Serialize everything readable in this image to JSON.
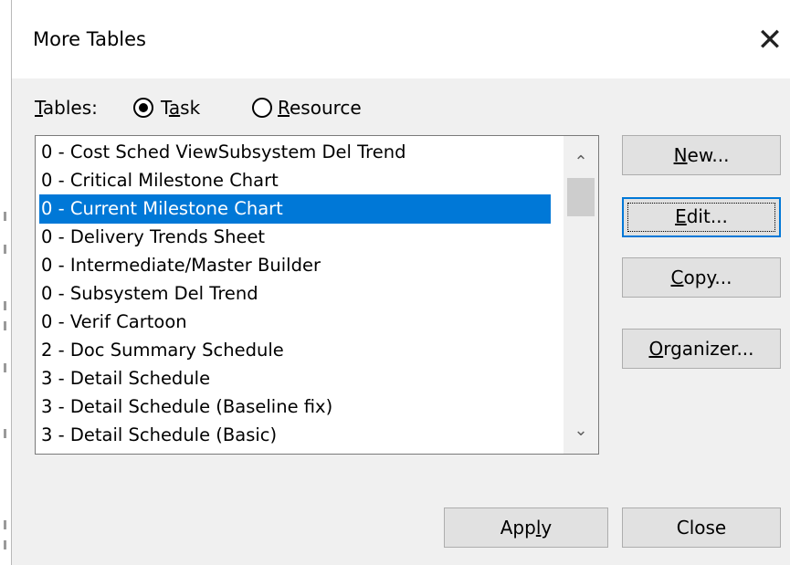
{
  "dialog": {
    "title": "More Tables",
    "close_glyph": "✕"
  },
  "tables_selector": {
    "label": "Tables:",
    "options": [
      {
        "label": "Task",
        "mnemonic_index": 1,
        "selected": true
      },
      {
        "label": "Resource",
        "mnemonic_index": 0,
        "selected": false
      }
    ]
  },
  "table_list": {
    "items": [
      "0 - Cost Sched ViewSubsystem Del Trend",
      "0 - Critical Milestone Chart",
      "0 - Current Milestone Chart",
      "0 - Delivery Trends Sheet",
      "0 - Intermediate/Master Builder",
      "0 - Subsystem Del Trend",
      "0 - Verif Cartoon",
      "2 - Doc Summary Schedule",
      "3 - Detail Schedule",
      "3 - Detail Schedule (Baseline fix)",
      "3 - Detail Schedule (Basic)"
    ],
    "selected_index": 2,
    "scroll_up_icon": "chevron-up-icon",
    "scroll_down_icon": "chevron-down-icon"
  },
  "side_buttons": {
    "new": {
      "label": "New...",
      "mnemonic_index": 0
    },
    "edit": {
      "label": "Edit...",
      "mnemonic_index": 0
    },
    "copy": {
      "label": "Copy...",
      "mnemonic_index": 0
    },
    "organizer": {
      "label": "Organizer...",
      "mnemonic_index": 0
    }
  },
  "footer_buttons": {
    "apply": {
      "label": "Apply",
      "mnemonic_index": 3
    },
    "close": {
      "label": "Close"
    }
  },
  "colors": {
    "selection": "#0078d7",
    "dialog_bg": "#f0f0f0",
    "button_bg": "#e1e1e1",
    "default_button_border": "#0078d7"
  }
}
